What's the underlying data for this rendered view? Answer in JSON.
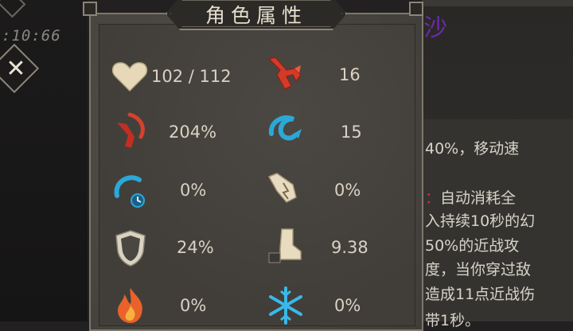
{
  "hud": {
    "timer": ":10:66"
  },
  "panel": {
    "title": "角色属性"
  },
  "stats": [
    {
      "id": "health",
      "icon": "heart-icon",
      "value": "102 / 112"
    },
    {
      "id": "attack",
      "icon": "attack-hand-icon",
      "value": "16"
    },
    {
      "id": "crit-damage",
      "icon": "crit-strike-icon",
      "value": "204%"
    },
    {
      "id": "crit-chance",
      "icon": "spiral-strike-icon",
      "value": "15"
    },
    {
      "id": "cooldown",
      "icon": "swirl-clock-icon",
      "value": "0%"
    },
    {
      "id": "dodge",
      "icon": "broken-scroll-icon",
      "value": "0%"
    },
    {
      "id": "armor",
      "icon": "shield-icon",
      "value": "24%"
    },
    {
      "id": "speed",
      "icon": "boot-icon",
      "value": "9.38"
    },
    {
      "id": "fire-resist",
      "icon": "fire-icon",
      "value": "0%"
    },
    {
      "id": "frost-resist",
      "icon": "snowflake-icon",
      "value": "0%"
    }
  ],
  "side": {
    "title_fragment": "沙",
    "lines": [
      {
        "highlight": "",
        "text": "40%，移动速"
      },
      {
        "highlight": "：",
        "text": "自动消耗全"
      },
      {
        "highlight": "",
        "text": "入持续10秒的幻"
      },
      {
        "highlight": "",
        "text": "50%的近战攻"
      },
      {
        "highlight": "",
        "text": "度，当你穿过敌"
      },
      {
        "highlight": "",
        "text": "造成11点近战伤"
      },
      {
        "highlight": "",
        "text": "带1秒。"
      }
    ]
  },
  "colors": {
    "panel": "#4a4742",
    "border": "#8c8578",
    "accent_red": "#c9302c",
    "accent_blue": "#2aa8d8",
    "title_purple": "#6b2aa8"
  }
}
